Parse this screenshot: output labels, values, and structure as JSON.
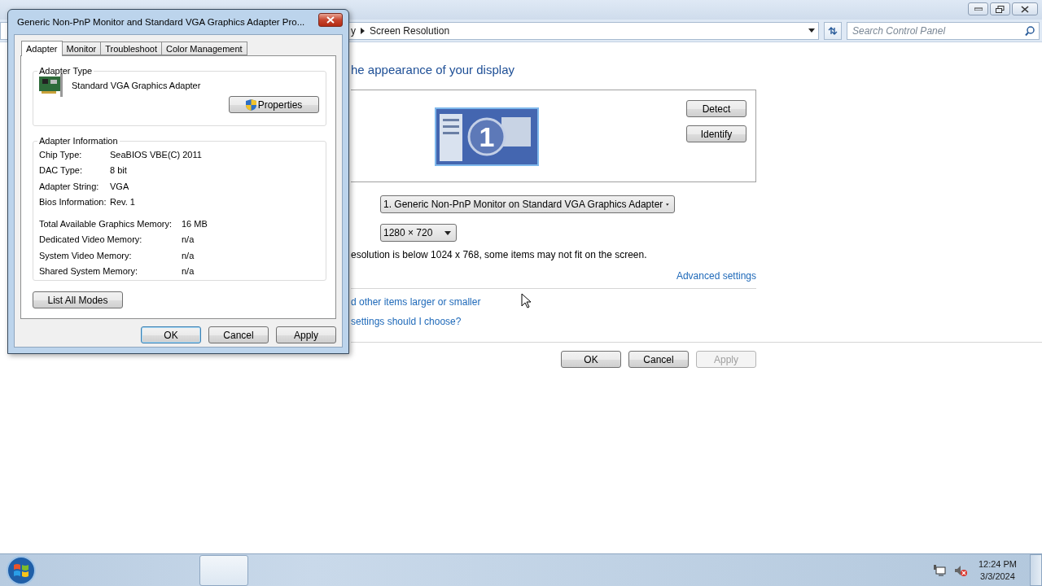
{
  "main_window": {
    "breadcrumb": [
      {
        "label": "y"
      },
      {
        "label": "Screen Resolution"
      }
    ],
    "search": {
      "placeholder": "Search Control Panel"
    },
    "heading": "he appearance of your display",
    "monitor_number": "1",
    "display_buttons": [
      {
        "label": "Detect"
      },
      {
        "label": "Identify"
      }
    ],
    "display_select": {
      "value": "1. Generic Non-PnP Monitor on Standard VGA Graphics Adapter"
    },
    "resolution_select": {
      "value": "1280 × 720"
    },
    "warning": "esolution is below 1024 x 768, some items may not fit on the screen.",
    "advanced_link": "Advanced settings",
    "links": [
      "d other items larger or smaller",
      "settings should I choose?"
    ],
    "buttons": [
      {
        "label": "OK",
        "disabled": false
      },
      {
        "label": "Cancel",
        "disabled": false
      },
      {
        "label": "Apply",
        "disabled": true
      }
    ]
  },
  "dialog": {
    "title": "Generic Non-PnP Monitor and Standard VGA Graphics Adapter Pro...",
    "tabs": [
      {
        "label": "Adapter",
        "selected": true
      },
      {
        "label": "Monitor",
        "selected": false
      },
      {
        "label": "Troubleshoot",
        "selected": false
      },
      {
        "label": "Color Management",
        "selected": false
      }
    ],
    "adapter_type": {
      "legend": "Adapter Type",
      "name": "Standard VGA Graphics Adapter",
      "button": "Properties"
    },
    "adapter_info": {
      "legend": "Adapter Information",
      "rows": [
        {
          "label": "Chip Type:",
          "value": "SeaBIOS VBE(C) 2011"
        },
        {
          "label": "DAC Type:",
          "value": "8 bit"
        },
        {
          "label": "Adapter String:",
          "value": "VGA"
        },
        {
          "label": "Bios Information:",
          "value": "Rev. 1"
        }
      ],
      "memory_rows": [
        {
          "label": "Total Available Graphics Memory:",
          "value": "16 MB"
        },
        {
          "label": "Dedicated Video Memory:",
          "value": "n/a"
        },
        {
          "label": "System Video Memory:",
          "value": "n/a"
        },
        {
          "label": "Shared System Memory:",
          "value": "n/a"
        }
      ]
    },
    "list_modes_button": "List All Modes",
    "buttons": [
      {
        "label": "OK",
        "default": true
      },
      {
        "label": "Cancel",
        "default": false
      },
      {
        "label": "Apply",
        "default": false
      }
    ]
  },
  "taskbar": {
    "time": "12:24 PM",
    "date": "3/3/2024"
  }
}
